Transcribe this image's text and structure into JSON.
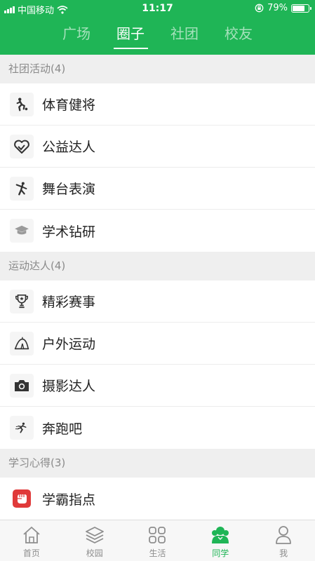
{
  "status_bar": {
    "carrier": "中国移动",
    "time": "11:17",
    "battery_percent": "79%",
    "battery_level": 0.79
  },
  "top_tabs": [
    {
      "label": "广场",
      "active": false
    },
    {
      "label": "圈子",
      "active": true
    },
    {
      "label": "社团",
      "active": false
    },
    {
      "label": "校友",
      "active": false
    }
  ],
  "sections": [
    {
      "title": "社团活动(4)",
      "items": [
        {
          "label": "体育健将",
          "icon": "sports-icon"
        },
        {
          "label": "公益达人",
          "icon": "heart-icon"
        },
        {
          "label": "舞台表演",
          "icon": "dance-icon"
        },
        {
          "label": "学术钻研",
          "icon": "graduation-cap-icon"
        }
      ]
    },
    {
      "title": "运动达人(4)",
      "items": [
        {
          "label": "精彩赛事",
          "icon": "trophy-icon"
        },
        {
          "label": "户外运动",
          "icon": "tent-icon"
        },
        {
          "label": "摄影达人",
          "icon": "camera-icon"
        },
        {
          "label": "奔跑吧",
          "icon": "runner-icon"
        }
      ]
    },
    {
      "title": "学习心得(3)",
      "items": [
        {
          "label": "学霸指点",
          "icon": "fist-icon"
        }
      ]
    }
  ],
  "bottom_tabs": [
    {
      "label": "首页",
      "icon": "home-icon",
      "active": false
    },
    {
      "label": "校园",
      "icon": "layers-icon",
      "active": false
    },
    {
      "label": "生活",
      "icon": "grid-icon",
      "active": false
    },
    {
      "label": "同学",
      "icon": "classmates-icon",
      "active": true
    },
    {
      "label": "我",
      "icon": "person-icon",
      "active": false
    }
  ],
  "colors": {
    "brand_green": "#1fb556",
    "inactive_gray": "#8e8e8e",
    "fist_red": "#e03a3a"
  }
}
